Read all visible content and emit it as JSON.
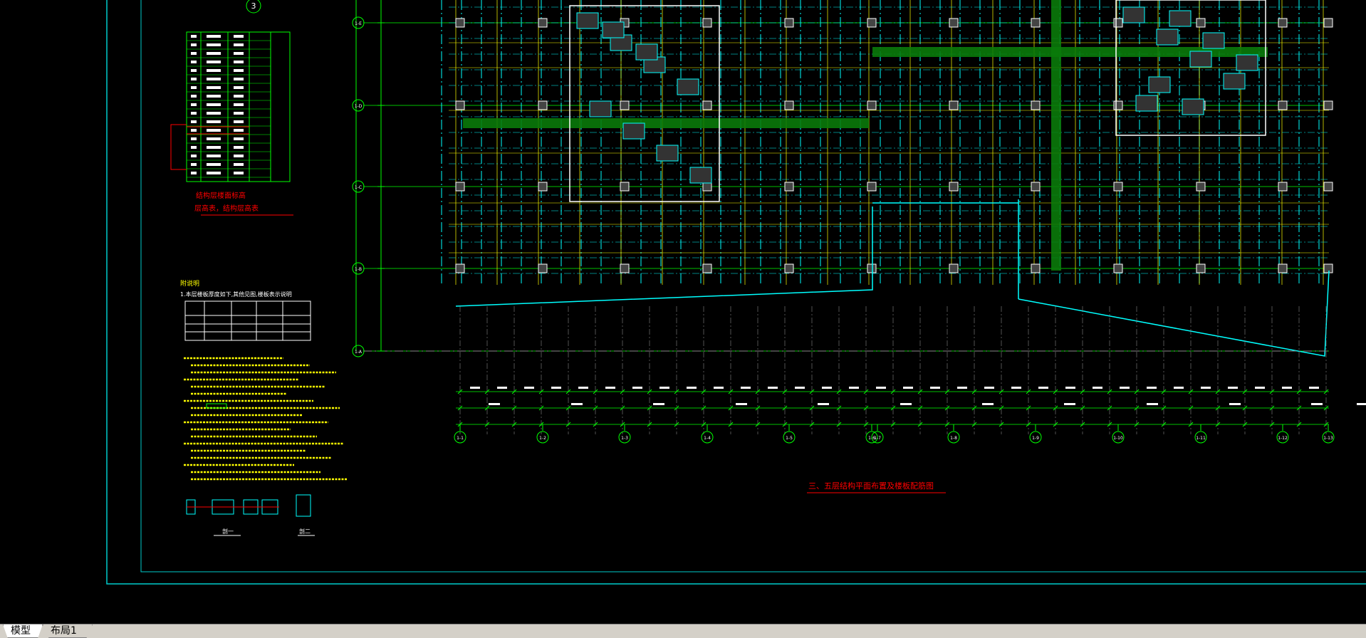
{
  "drawing": {
    "table_title_marker": "3",
    "legend_title": "结构层楼面标高",
    "legend_subtitle": "层高表，结构层高表",
    "notes_title": "附说明",
    "notes_line1": "1.本层楼板厚度如下,其他见图,楼板表示说明",
    "plan_caption": "三、五层结构平面布置及楼板配筋图",
    "axis_labels_bottom": [
      "1-1",
      "1-2",
      "1-3",
      "1-4",
      "1-5",
      "1-6",
      "1-7",
      "1-8",
      "1-9",
      "1-10",
      "1-11",
      "1-12",
      "1-13"
    ],
    "axis_labels_left": [
      "1-E",
      "1-D",
      "1-C",
      "1-B",
      "1-A"
    ],
    "detail_labels": [
      "剖一",
      "剖二"
    ],
    "colors": {
      "background": "#000000",
      "cyan": "#00ffff",
      "green": "#00ff00",
      "yellow": "#ffff00",
      "red": "#ff0000",
      "white": "#ffffff",
      "frame": "#00cccc"
    }
  },
  "tabs": [
    {
      "label": "模型"
    },
    {
      "label": "布局1"
    }
  ]
}
